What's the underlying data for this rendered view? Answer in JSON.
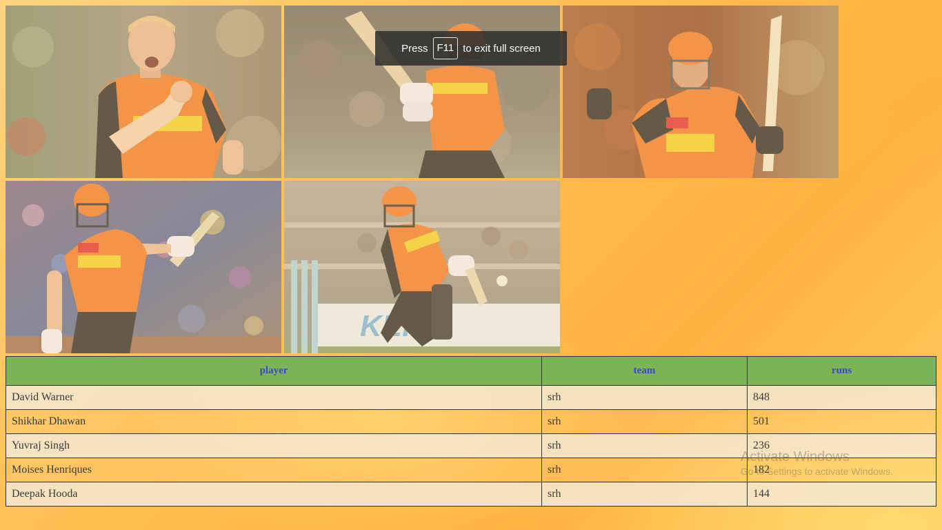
{
  "fullscreen_notice": {
    "prefix": "Press",
    "key": "F11",
    "suffix": "to exit full screen"
  },
  "gallery": {
    "photos": [
      {
        "subject": "cricketer celebrating in orange jersey"
      },
      {
        "subject": "batsman playing a shot in orange jersey"
      },
      {
        "subject": "batsman raising bat in orange jersey"
      },
      {
        "subject": "batsman walking with raised bat"
      },
      {
        "subject": "batsman driving the ball near stumps"
      }
    ]
  },
  "table": {
    "headers": [
      "player",
      "team",
      "runs"
    ],
    "rows": [
      {
        "player": "David Warner",
        "team": "srh",
        "runs": "848"
      },
      {
        "player": "Shikhar Dhawan",
        "team": "srh",
        "runs": "501"
      },
      {
        "player": "Yuvraj Singh",
        "team": "srh",
        "runs": "236"
      },
      {
        "player": "Moises Henriques",
        "team": "srh",
        "runs": "182"
      },
      {
        "player": "Deepak Hooda",
        "team": "srh",
        "runs": "144"
      }
    ]
  },
  "watermark": {
    "title": "Activate Windows",
    "subtitle": "Go to Settings to activate Windows."
  },
  "colors": {
    "header_bg": "#7ab457",
    "header_text": "#3d47c8",
    "jersey_orange": "#f07a2a",
    "background": "#ffbe52"
  }
}
